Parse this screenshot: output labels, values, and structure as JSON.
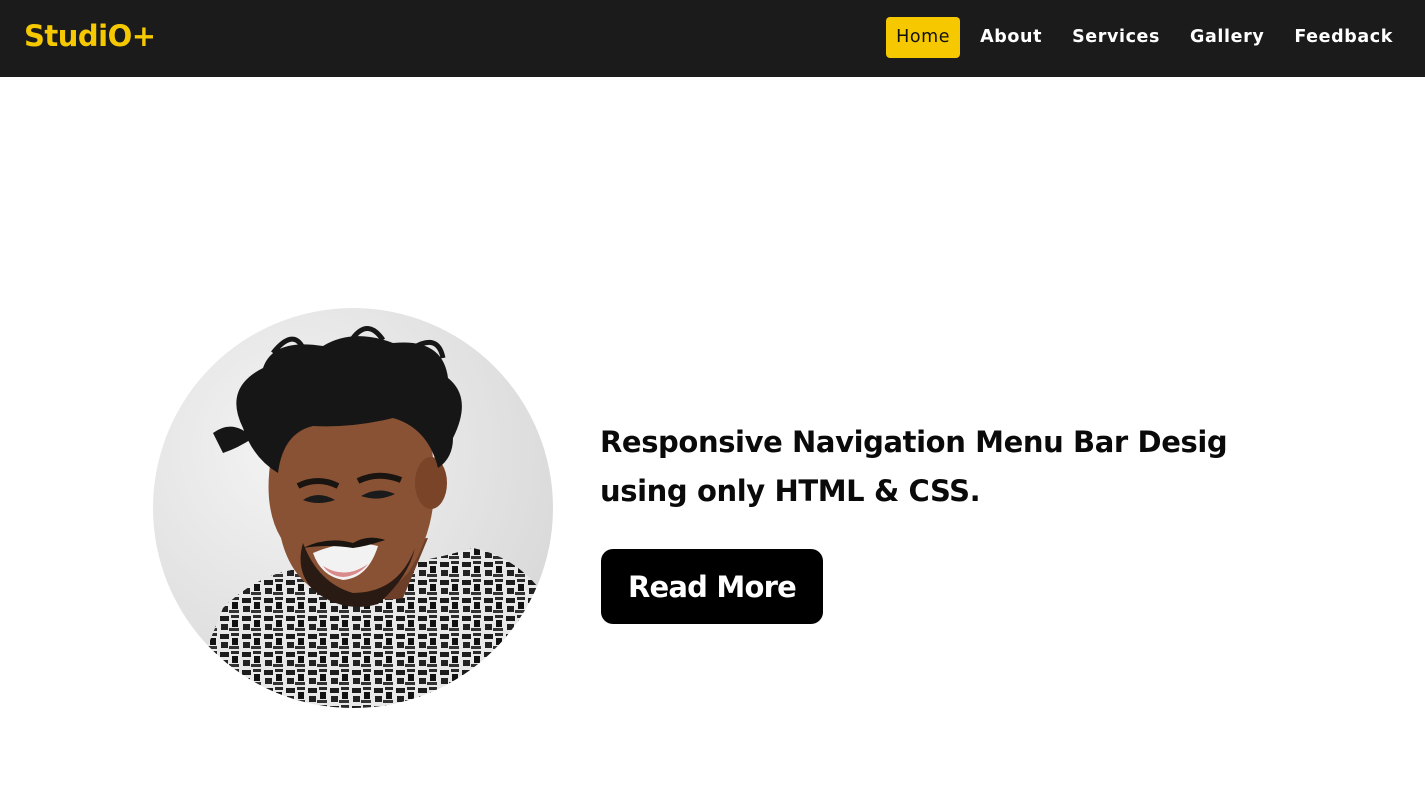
{
  "brand": {
    "name": "StudiO+"
  },
  "nav": {
    "items": [
      {
        "label": "Home",
        "active": true
      },
      {
        "label": "About",
        "active": false
      },
      {
        "label": "Services",
        "active": false
      },
      {
        "label": "Gallery",
        "active": false
      },
      {
        "label": "Feedback",
        "active": false
      }
    ]
  },
  "hero": {
    "title_line1": "Responsive Navigation Menu Bar Desig",
    "title_line2": "using only HTML & CSS.",
    "button_label": "Read More",
    "image_subject": "smiling-man-portrait"
  },
  "colors": {
    "nav_background": "#1b1b1b",
    "accent": "#f5c800",
    "nav_text": "#ffffff",
    "button_background": "#000000",
    "button_text": "#ffffff"
  }
}
